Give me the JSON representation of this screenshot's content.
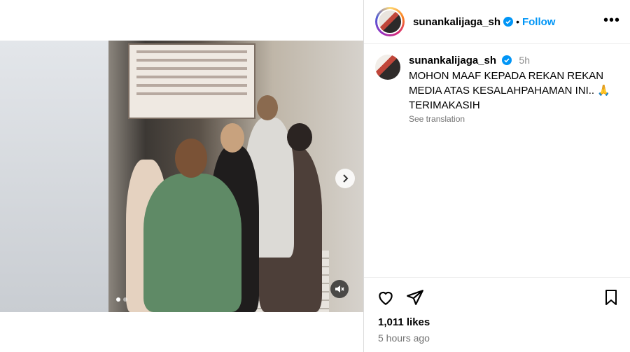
{
  "post": {
    "username": "sunankalijaga_sh",
    "separator": "•",
    "follow_label": "Follow",
    "more_icon": "more-options-icon",
    "time": "5h",
    "caption_lines": [
      "MOHON MAAF KEPADA REKAN REKAN",
      "MEDIA ATAS KESALAHPAHAMAN INI.. 🙏",
      "TERIMAKASIH"
    ],
    "see_translation": "See translation",
    "likes": "1,011 likes",
    "posted_ago": "5 hours ago"
  },
  "media": {
    "carousel_index": 1,
    "carousel_count": 2,
    "next_icon": "chevron-right-icon",
    "mute_icon": "speaker-muted-icon"
  },
  "colors": {
    "accent": "#0095f6",
    "verified": "#0095f6"
  }
}
